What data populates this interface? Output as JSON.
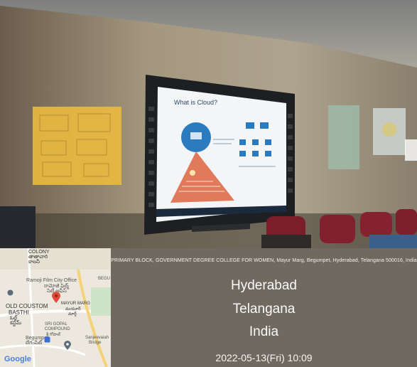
{
  "screen": {
    "slide_title": "What is Cloud?"
  },
  "map": {
    "labels": {
      "colony": "COLONY",
      "colony_te": "తాతాచారి",
      "colony_te2": "కాలనీ",
      "film_city": "Ramoji Film City Office",
      "film_city_te": "రామోజీ ఫిల్మ్",
      "film_city_te2": "సిటీ ఆఫీస్",
      "old_custom": "OLD COUSTOM",
      "basthi": "BASTHI",
      "basthi_te": "ఓల్డ్",
      "basthi_te2": "కస్టమ్",
      "mayur": "MAYUR MARG",
      "mayur_te": "మయూర్",
      "mayur_te2": "మార్గ్",
      "gopal": "SRI GOPAL",
      "gopal2": "COMPOUND",
      "gopal_te": "శ్రీ గోపాల్",
      "begumpet": "Begumpet",
      "begumpet_te": "బేగంపేట్",
      "sanjeevaiah": "Sanjeevaiah",
      "sanjeevaiah2": "Bridge",
      "begu": "BEGU",
      "google": "Google"
    }
  },
  "overlay": {
    "address": "PRIMARY BLOCK, GOVERNMENT DEGREE COLLEGE FOR WOMEN, Mayur Marg, Begumpet, Hyderabad, Telangana 500016, India",
    "city": "Hyderabad",
    "state": "Telangana",
    "country": "India",
    "timestamp": "2022-05-13(Fri)   10:09"
  }
}
